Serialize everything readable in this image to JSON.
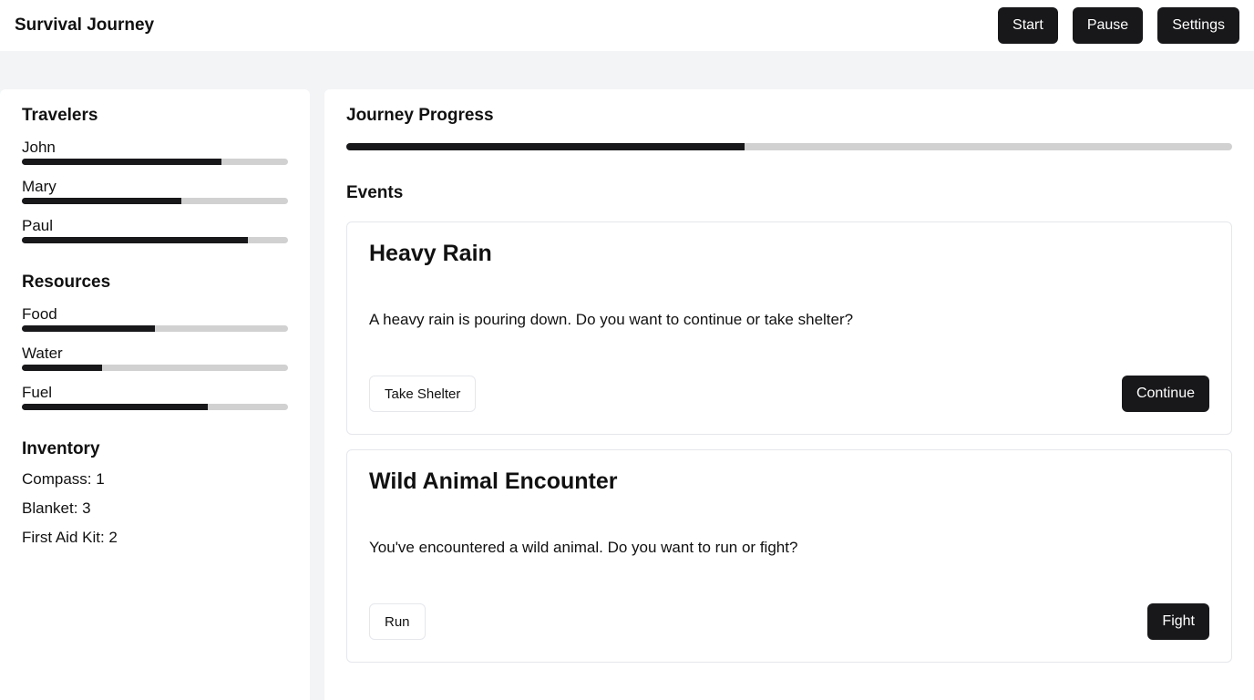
{
  "header": {
    "title": "Survival Journey",
    "start_label": "Start",
    "pause_label": "Pause",
    "settings_label": "Settings"
  },
  "sidebar": {
    "travelers_title": "Travelers",
    "travelers": [
      {
        "name": "John",
        "health": 0.75
      },
      {
        "name": "Mary",
        "health": 0.6
      },
      {
        "name": "Paul",
        "health": 0.85
      }
    ],
    "resources_title": "Resources",
    "resources": [
      {
        "name": "Food",
        "level": 0.5
      },
      {
        "name": "Water",
        "level": 0.3
      },
      {
        "name": "Fuel",
        "level": 0.7
      }
    ],
    "inventory_title": "Inventory",
    "inventory": [
      "Compass: 1",
      "Blanket: 3",
      "First Aid Kit: 2"
    ]
  },
  "main": {
    "progress_title": "Journey Progress",
    "progress": 0.45,
    "events_title": "Events",
    "events": [
      {
        "title": "Heavy Rain",
        "description": "A heavy rain is pouring down. Do you want to continue or take shelter?",
        "secondary_label": "Take Shelter",
        "primary_label": "Continue"
      },
      {
        "title": "Wild Animal Encounter",
        "description": "You've encountered a wild animal. Do you want to run or fight?",
        "secondary_label": "Run",
        "primary_label": "Fight"
      }
    ]
  }
}
